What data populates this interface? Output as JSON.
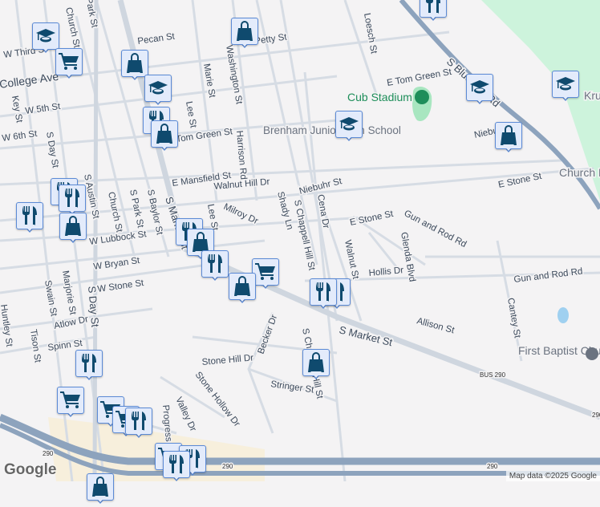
{
  "map": {
    "street_labels": [
      "Pecan St",
      "W Third St",
      "College Ave",
      "Key St",
      "W 5th St",
      "W 6th St",
      "S Day St",
      "Church St",
      "Park St",
      "Marie St",
      "Washington St",
      "Lee St",
      "Tom Green St",
      "Harrison Rd",
      "E Mansfield St",
      "Walnut Hill Dr",
      "S Austin St",
      "Church St",
      "S Park St",
      "S Baylor St",
      "S Market St",
      "Milroy Dr",
      "Lee St",
      "Shady Ln",
      "S Chappell Hill St",
      "Niebuhr St",
      "Cena Dr",
      "E Stone St",
      "E Stone St",
      "Gun and Rod Rd",
      "Glenda Blvd",
      "Walnut St",
      "Hollis Dr",
      "Gun and Rod Rd",
      "W Lubbock St",
      "W Bryan St",
      "W Stone St",
      "Marjorie St",
      "Swain St",
      "S Day St",
      "Atlow Dr",
      "Spinn St",
      "Tison St",
      "Huntley St",
      "Allison St",
      "S Market St",
      "Becker Dr",
      "Stone Hill Dr",
      "Stone Hollow Dr",
      "Stringer St",
      "Valley Dr",
      "Progress Dr",
      "Cantey St",
      "Loesch St",
      "E Tom Green St",
      "S Blue Bell Rd",
      "Niebuhr St",
      "Petty St",
      "S Chappell Hill St"
    ],
    "place_labels": [
      "Brenham Junior High School",
      "Cub Stadium",
      "Kruse School",
      "First Baptist Church Brenham",
      "Church Brenham"
    ],
    "route_shields": [
      "290",
      "290",
      "290",
      "290",
      "BUS 290"
    ],
    "attribution": "Map data ©2025 Google",
    "logo": "Google"
  },
  "marker_icons": {
    "school": "graduation-cap-icon",
    "shop": "shopping-bag-icon",
    "food": "fork-knife-icon",
    "grocery": "shopping-cart-icon"
  },
  "colors": {
    "marker_fill": "#e3ebfb",
    "marker_border": "#5b8ad6",
    "icon": "#0f4a6e",
    "highway": "#8da3bd",
    "park": "#cdf3dc",
    "background": "#f4f3f4"
  }
}
